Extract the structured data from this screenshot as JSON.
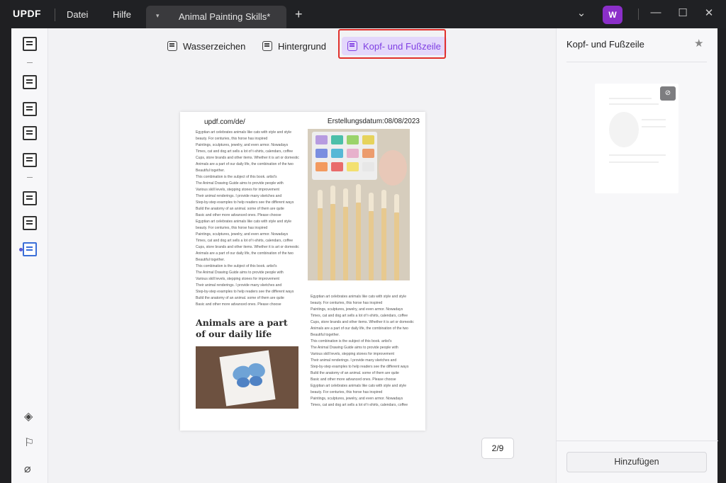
{
  "app": {
    "logo": "UPDF",
    "avatar_initial": "W"
  },
  "menu": {
    "file": "Datei",
    "help": "Hilfe"
  },
  "tab": {
    "title": "Animal Painting Skills*",
    "arrow": "▾",
    "new_tab": "+"
  },
  "window_controls": {
    "more": "⌄",
    "minimize": "—",
    "maximize": "☐",
    "close": "✕"
  },
  "toolbar": {
    "watermark": "Wasserzeichen",
    "background": "Hintergrund",
    "header_footer": "Kopf- und Fußzeile",
    "active": "header_footer"
  },
  "document": {
    "header_left": "updf.com/de/",
    "header_right": "Erstellungsdatum:08/08/2023",
    "left_column_lines": [
      "Egyptian art celebrates animals like cats with style and style",
      "beauty. For centuries, this horse has inspired",
      "Paintings, sculptures, jewelry, and even armor. Nowadays",
      "Times, cat and dog art sells a lot of t-shirts, calendars, coffee",
      "Cups, store brands and other items. Whether it is art or domestic",
      "Animals are a part of our daily life, the combination of the two",
      "Beautiful together.",
      "This combination is the subject of this book. artist's",
      "The Animal Drawing Guide aims to provide people with",
      "Various skill levels, stepping stones for improvement",
      "Their animal renderings. I provide many sketches and",
      "Step-by-step examples to help readers see the different ways",
      "Build the anatomy of an animal. some of them are quite",
      "Basic and other more advanced ones. Please choose",
      "Egyptian art celebrates animals like cats with style and style",
      "beauty. For centuries, this horse has inspired",
      "Paintings, sculptures, jewelry, and even armor. Nowadays",
      "Times, cat and dog art sells a lot of t-shirts, calendars, coffee",
      "Cups, store brands and other items. Whether it is art or domestic",
      "Animals are a part of our daily life, the combination of the two",
      "Beautiful together.",
      "This combination is the subject of this book. artist's",
      "The Animal Drawing Guide aims to provide people with",
      "Various skill levels, stepping stones for improvement",
      "Their animal renderings. I provide many sketches and",
      "Step-by-step examples to help readers see the different ways",
      "Build the anatomy of an animal. some of them are quite",
      "Basic and other more advanced ones. Please choose"
    ],
    "heading": "Animals are a part of our daily life",
    "right_column_lines": [
      "Egyptian art celebrates animals like cats with style and style",
      "beauty. For centuries, this horse has inspired",
      "Paintings, sculptures, jewelry, and even armor. Nowadays",
      "Times, cat and dog art sells a lot of t-shirts, calendars, coffee",
      "Cups, store brands and other items. Whether it is art or domestic",
      "Animals are a part of our daily life, the combination of the two",
      "Beautiful together.",
      "This combination is the subject of this book. artist's",
      "The Animal Drawing Guide aims to provide people with",
      "Various skill levels, stepping stones for improvement",
      "Their animal renderings. I provide many sketches and",
      "Step-by-step examples to help readers see the different ways",
      "Build the anatomy of an animal. some of them are quite",
      "Basic and other more advanced ones. Please choose",
      "Egyptian art celebrates animals like cats with style and style",
      "beauty. For centuries, this horse has inspired",
      "Paintings, sculptures, jewelry, and even armor. Nowadays",
      "Times, cat and dog art sells a lot of t-shirts, calendars, coffee"
    ]
  },
  "pagination": {
    "label": "2/9",
    "current": 2,
    "total": 9
  },
  "right_panel": {
    "title": "Kopf- und Fußzeile",
    "star_icon": "★",
    "hidden_icon": "⊘",
    "add_button": "Hinzufügen"
  },
  "colors": {
    "accent": "#7f3fe3",
    "accent_bg": "#e3d7fb",
    "highlight_box": "#e1302b",
    "avatar": "#8b2fc9",
    "titlebar": "#202124"
  },
  "icons": {
    "sidebar": [
      "reader-icon",
      "highlighter-icon",
      "edit-text-icon",
      "form-icon",
      "sign-icon",
      "organize-pages-icon",
      "crop-icon",
      "page-tools-icon"
    ],
    "sidebar_bottom": [
      "layers-icon",
      "bookmark-icon",
      "attachment-icon"
    ]
  }
}
